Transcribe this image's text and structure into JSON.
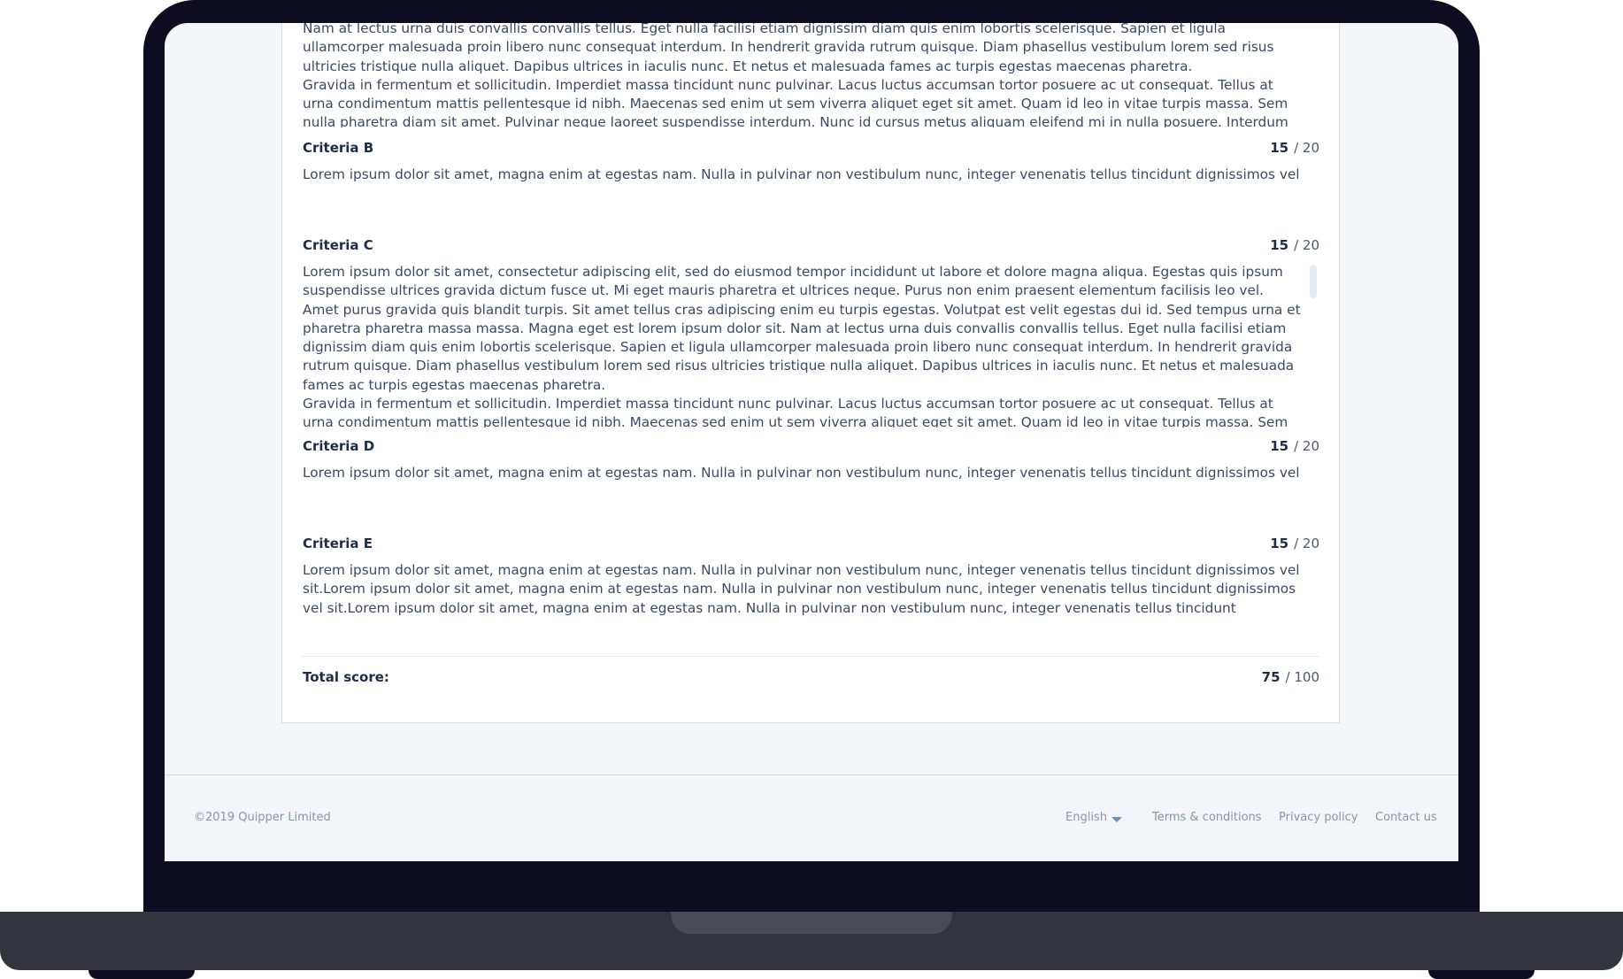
{
  "criteria": {
    "a_partial_text": [
      "Nam at lectus urna duis convallis convallis tellus. Eget nulla facilisi etiam dignissim diam quis enim lobortis scelerisque. Sapien et ligula ullamcorper malesuada proin libero nunc consequat interdum. In hendrerit gravida rutrum quisque. Diam phasellus vestibulum lorem sed risus ultricies tristique nulla aliquet. Dapibus ultrices in iaculis nunc. Et netus et malesuada fames ac turpis egestas maecenas pharetra.",
      "Gravida in fermentum et sollicitudin. Imperdiet massa tincidunt nunc pulvinar. Lacus luctus accumsan tortor posuere ac ut consequat. Tellus at urna condimentum mattis pellentesque id nibh. Maecenas sed enim ut sem viverra aliquet eget sit amet. Quam id leo in vitae turpis massa. Sem nulla pharetra diam sit amet. Pulvinar neque laoreet suspendisse interdum. Nunc id cursus metus aliquam eleifend mi in nulla posuere. Interdum consectetur libero id faucibus nisl tincidunt eget. Cursus sit amet dictum sit"
    ],
    "b": {
      "title": "Criteria B",
      "score": "15",
      "max": "/ 20",
      "text": "Lorem ipsum dolor sit amet, magna enim at egestas nam. Nulla in pulvinar non vestibulum nunc, integer venenatis tellus tincidunt dignissimos vel sit."
    },
    "c": {
      "title": "Criteria C",
      "score": "15",
      "max": "/ 20",
      "paragraphs": [
        "Lorem ipsum dolor sit amet, consectetur adipiscing elit, sed do eiusmod tempor incididunt ut labore et dolore magna aliqua. Egestas quis ipsum suspendisse ultrices gravida dictum fusce ut. Mi eget mauris pharetra et ultrices neque. Purus non enim praesent elementum facilisis leo vel. Amet purus gravida quis blandit turpis. Sit amet tellus cras adipiscing enim eu turpis egestas. Volutpat est velit egestas dui id. Sed tempus urna et pharetra pharetra massa massa. Magna eget est lorem ipsum dolor sit. Nam at lectus urna duis convallis convallis tellus. Eget nulla facilisi etiam dignissim diam quis enim lobortis scelerisque. Sapien et ligula ullamcorper malesuada proin libero nunc consequat interdum. In hendrerit gravida rutrum quisque. Diam phasellus vestibulum lorem sed risus ultricies tristique nulla aliquet. Dapibus ultrices in iaculis nunc. Et netus et malesuada fames ac turpis egestas maecenas pharetra.",
        "Gravida in fermentum et sollicitudin. Imperdiet massa tincidunt nunc pulvinar. Lacus luctus accumsan tortor posuere ac ut consequat. Tellus at urna condimentum mattis pellentesque id nibh. Maecenas sed enim ut sem viverra aliquet eget sit amet. Quam id leo in vitae turpis massa. Sem nulla pharetra diam sit amet. Pulvinar neque laoreet suspendisse interdum. Nunc id cursus metus aliquam eleifend mi in nulla posuere. Interdum consectetur libero id faucibus nisl tincidunt eget. Cursus sit amet dictum sit"
      ]
    },
    "d": {
      "title": "Criteria D",
      "score": "15",
      "max": "/ 20",
      "text": "Lorem ipsum dolor sit amet, magna enim at egestas nam. Nulla in pulvinar non vestibulum nunc, integer venenatis tellus tincidunt dignissimos vel sit."
    },
    "e": {
      "title": "Criteria E",
      "score": "15",
      "max": "/ 20",
      "text": "Lorem ipsum dolor sit amet, magna enim at egestas nam. Nulla in pulvinar non vestibulum nunc, integer venenatis tellus tincidunt dignissimos vel sit.Lorem ipsum dolor sit amet, magna enim at egestas nam. Nulla in pulvinar non vestibulum nunc, integer venenatis tellus tincidunt dignissimos vel sit.Lorem ipsum dolor sit amet, magna enim at egestas nam. Nulla in pulvinar non vestibulum nunc, integer venenatis tellus tincidunt dignissimos vel sit.Lorem ipsum dolor sit amet, magna enim at egestas"
    }
  },
  "total": {
    "label": "Total score:",
    "score": "75",
    "max": "/ 100"
  },
  "footer": {
    "copyright": "©2019 Quipper Limited",
    "language": "English",
    "terms": "Terms & conditions",
    "privacy": "Privacy policy",
    "contact": "Contact us"
  },
  "colors": {
    "bezel": "#0d0c20",
    "screen_bg": "#f3f5f8",
    "text": "#3a4a66",
    "heading": "#1e2c48",
    "footer_text": "#8a96a8"
  }
}
